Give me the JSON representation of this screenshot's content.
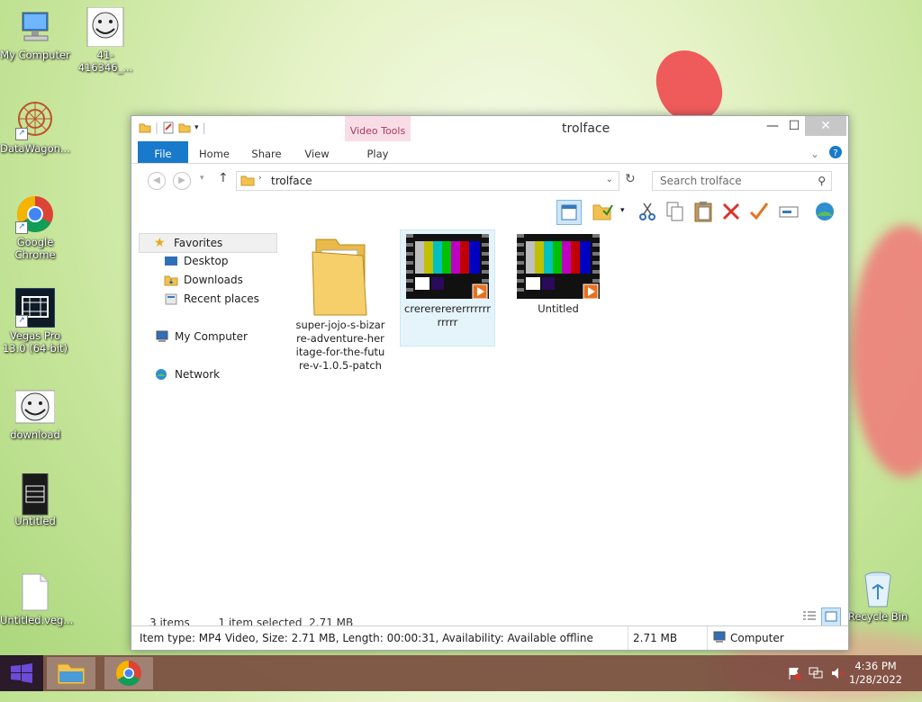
{
  "desktop": {
    "icons": [
      {
        "label": "My Computer",
        "icon": "computer-icon"
      },
      {
        "label": "41-416346_...",
        "icon": "trollface-image-icon"
      },
      {
        "label": "DataWagon...",
        "icon": "datawagon-icon"
      },
      {
        "label": "Google Chrome",
        "icon": "chrome-icon"
      },
      {
        "label": "Vegas Pro 13.0 (64-bit)",
        "icon": "vegas-pro-icon"
      },
      {
        "label": "download",
        "icon": "trollface-image-icon"
      },
      {
        "label": "Untitled",
        "icon": "sony-video-icon"
      },
      {
        "label": "Untitled.veg...",
        "icon": "blank-file-icon"
      },
      {
        "label": "Recycle Bin",
        "icon": "recycle-bin-icon"
      }
    ]
  },
  "window": {
    "title": "trolface",
    "context_tab_group": "Video Tools",
    "ribbon_tabs": [
      "File",
      "Home",
      "Share",
      "View",
      "Play"
    ],
    "address_path": "trolface",
    "search_placeholder": "Search trolface",
    "nav": {
      "favorites": "Favorites",
      "desktop": "Desktop",
      "downloads": "Downloads",
      "recent": "Recent places",
      "computer": "My Computer",
      "network": "Network"
    },
    "files": [
      {
        "name": "super-jojo-s-bizarre-adventure-heritage-for-the-future-v-1.0.5-patch",
        "type": "folder"
      },
      {
        "name": "crerererererrrrrrrrrrrr",
        "type": "video",
        "selected": true
      },
      {
        "name": "Untitled",
        "type": "video"
      }
    ],
    "status_items": "3 items",
    "status_selected": "1 item selected  2.71 MB",
    "details": "Item type: MP4 Video, Size: 2.71 MB, Length: 00:00:31, Availability: Available offline",
    "details_size": "2.71 MB",
    "details_location": "Computer"
  },
  "taskbar": {
    "time": "4:36 PM",
    "date": "1/28/2022"
  },
  "colors": {
    "file_tab": "#1979ca",
    "context_tab": "#f9dde6",
    "selection": "#e5f3fb",
    "taskbar": "#7a463c"
  }
}
